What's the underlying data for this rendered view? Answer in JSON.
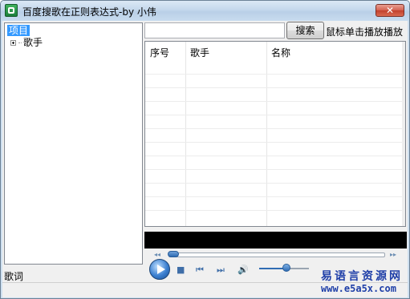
{
  "window": {
    "title": "百度搜歌在正则表达式-by 小伟",
    "close_label": "✕"
  },
  "tree": {
    "root": "项目",
    "node": "歌手"
  },
  "search": {
    "value": "",
    "button_label": "搜索",
    "hint": "鼠标单击播放播放"
  },
  "listview": {
    "columns": [
      "序号",
      "歌手",
      "名称"
    ],
    "rows": []
  },
  "player": {
    "seek_back": "◂◂",
    "seek_fwd": "▸▸",
    "stop_icon": "■",
    "prev_icon": "⏮",
    "next_icon": "⏭",
    "volume_icon": "🔊",
    "seek_position": 0.0,
    "volume_level": 0.55
  },
  "lyrics": {
    "label": "歌词"
  },
  "watermark": {
    "title": "易语言资源网",
    "url": "www.e5a5x.com"
  },
  "colors": {
    "accent": "#3399ff",
    "watermark": "#1f3fa8",
    "close": "#c2402d"
  }
}
